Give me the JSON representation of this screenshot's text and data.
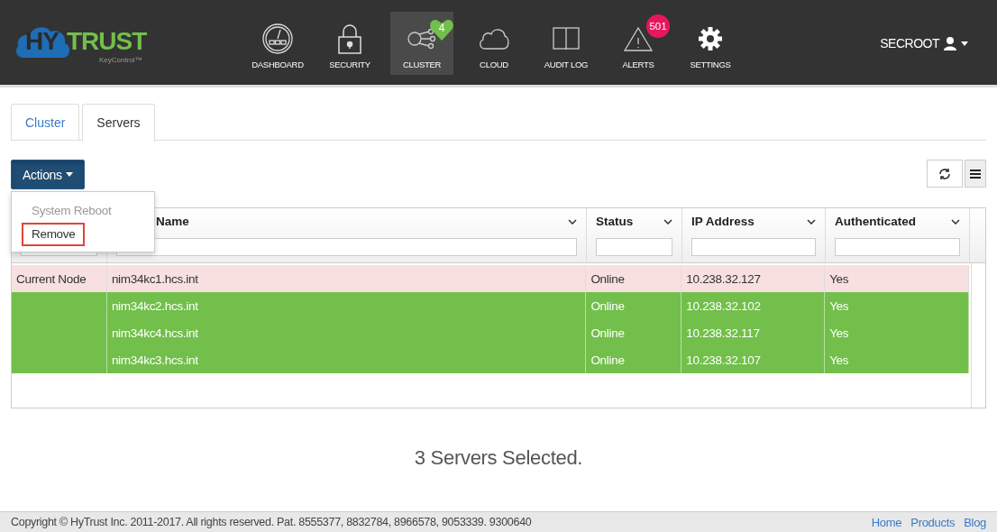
{
  "logo": {
    "mark": "HY",
    "word": "TRUST",
    "product": "KeyControl™"
  },
  "nav": [
    {
      "label": "DASHBOARD",
      "kind": "dashboard",
      "selected": false
    },
    {
      "label": "SECURITY",
      "kind": "lock",
      "selected": false
    },
    {
      "label": "CLUSTER",
      "kind": "cluster",
      "selected": true,
      "badge": {
        "text": "4",
        "kind": "heart"
      }
    },
    {
      "label": "CLOUD",
      "kind": "cloud",
      "selected": false
    },
    {
      "label": "AUDIT LOG",
      "kind": "book",
      "selected": false
    },
    {
      "label": "ALERTS",
      "kind": "alert",
      "selected": false,
      "badge": {
        "text": "501",
        "kind": "circle"
      }
    },
    {
      "label": "SETTINGS",
      "kind": "gear",
      "selected": false
    }
  ],
  "user": {
    "name": "SECROOT"
  },
  "tabs": [
    {
      "label": "Cluster",
      "selected": false
    },
    {
      "label": "Servers",
      "selected": true
    }
  ],
  "actions": {
    "label": "Actions",
    "expanded": true,
    "menu": [
      {
        "label": "System Reboot",
        "disabled": true,
        "highlighted": false
      },
      {
        "label": "Remove",
        "disabled": false,
        "highlighted": true
      }
    ]
  },
  "table": {
    "columns": [
      {
        "label": "Name"
      },
      {
        "label": "Status"
      },
      {
        "label": "IP Address"
      },
      {
        "label": "Authenticated"
      }
    ],
    "rows": [
      {
        "node": "Current Node",
        "name": "nim34kc1.hcs.int",
        "status": "Online",
        "ip": "10.238.32.127",
        "authenticated": "Yes",
        "current": true,
        "selected": false
      },
      {
        "name": "nim34kc2.hcs.int",
        "status": "Online",
        "ip": "10.238.32.102",
        "authenticated": "Yes",
        "current": false,
        "selected": true
      },
      {
        "name": "nim34kc4.hcs.int",
        "status": "Online",
        "ip": "10.238.32.117",
        "authenticated": "Yes",
        "current": false,
        "selected": true
      },
      {
        "name": "nim34kc3.hcs.int",
        "status": "Online",
        "ip": "10.238.32.107",
        "authenticated": "Yes",
        "current": false,
        "selected": true
      }
    ]
  },
  "selection_message": "3 Servers Selected.",
  "footer": {
    "copyright": "Copyright © HyTrust Inc. 2011-2017. All rights reserved. Pat. 8555377, 8832784, 8966578, 9053339. 9300640",
    "links": [
      "Home",
      "Products",
      "Blog"
    ]
  }
}
